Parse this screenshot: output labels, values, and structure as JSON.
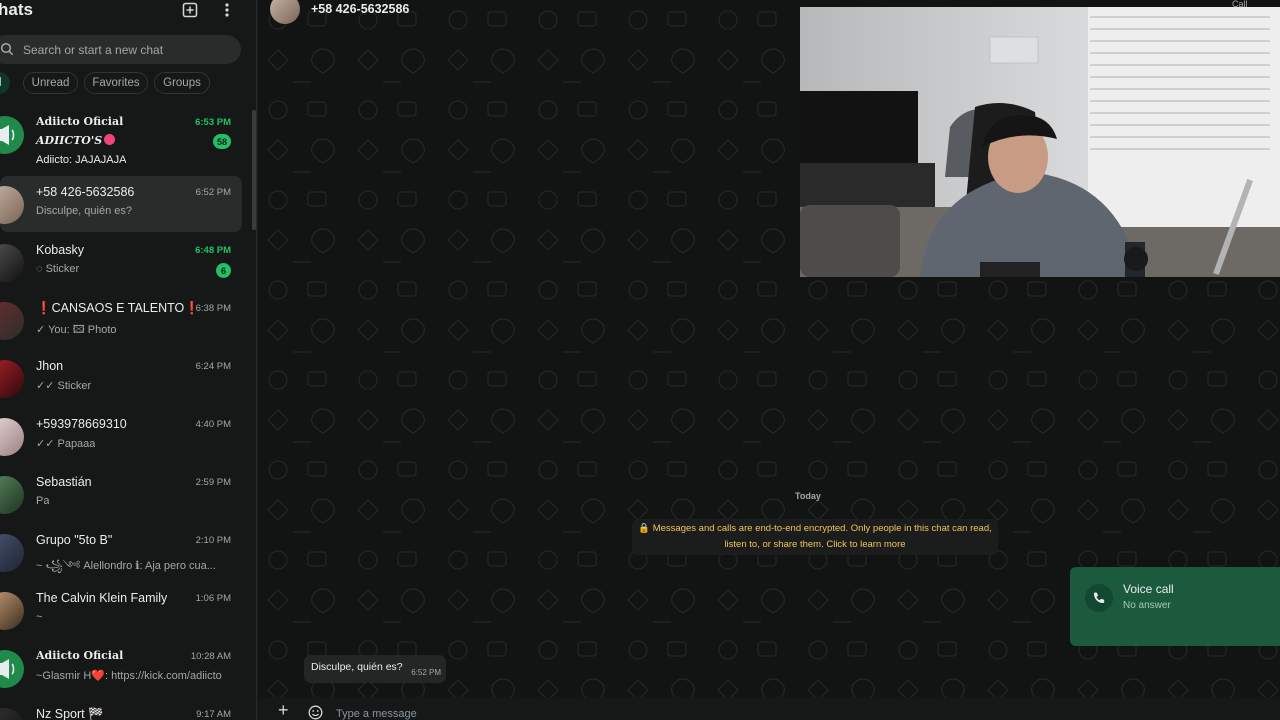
{
  "sidebar": {
    "title": "hats",
    "search_placeholder": "Search or start a new chat",
    "filters": [
      "All",
      "Unread",
      "Favorites",
      "Groups"
    ],
    "chats": [
      {
        "name": "Adiicto Oficial",
        "subtitle": "ADIICTO'S",
        "preview": "Adiicto: JAJAJAJA",
        "time": "6:53 PM",
        "unread_count": "58",
        "unread": true
      },
      {
        "name": "+58 426-5632586",
        "preview": "Disculpe, quién es?",
        "time": "6:52 PM",
        "selected": true
      },
      {
        "name": "Kobasky",
        "preview": "Sticker",
        "time": "6:48 PM",
        "unread_count": "6",
        "unread": true
      },
      {
        "name": "CANSAOS E TALENTO",
        "preview": "✓ You: 🖾 Photo",
        "time": "6:38 PM"
      },
      {
        "name": "Jhon",
        "preview": "✓✓ Sticker",
        "time": "6:24 PM"
      },
      {
        "name": "+593978669310",
        "preview": "✓✓ Papaaa",
        "time": "4:40 PM"
      },
      {
        "name": "Sebastián",
        "preview": "Pa",
        "time": "2:59 PM"
      },
      {
        "name": "Grupo \"5to B\"",
        "preview": "~ ꧁⁠༺ Alellondro ℹ︎: Aja pero cua...",
        "time": "2:10 PM"
      },
      {
        "name": "The Calvin Klein Family",
        "preview": "~",
        "time": "1:06 PM"
      },
      {
        "name": "Adiicto Oficial",
        "preview": "~Glasmir H❤️: https://kick.com/adiicto",
        "time": "10:28 AM"
      },
      {
        "name": "Nz Sport 🏁",
        "preview": "",
        "time": "9:17 AM"
      }
    ]
  },
  "conversation": {
    "contact": "+58 426-5632586",
    "day_label": "Today",
    "encryption_notice_line1": "🔒 Messages and calls are end-to-end encrypted. Only people in this chat can read,",
    "encryption_notice_line2": "listen to, or share them. Click to learn more",
    "messages": [
      {
        "text": "Disculpe, quién es?",
        "time": "6:52 PM"
      }
    ],
    "composer_placeholder": "Type a message"
  },
  "call_toast": {
    "title": "Voice call",
    "subtitle": "No answer"
  },
  "header_call_label": "Call",
  "colors": {
    "accent": "#21c063",
    "sidebar_bg": "#161717",
    "chat_bg": "#121313",
    "toast_bg": "#1c5a3d",
    "notice_text": "#f7c25c"
  }
}
